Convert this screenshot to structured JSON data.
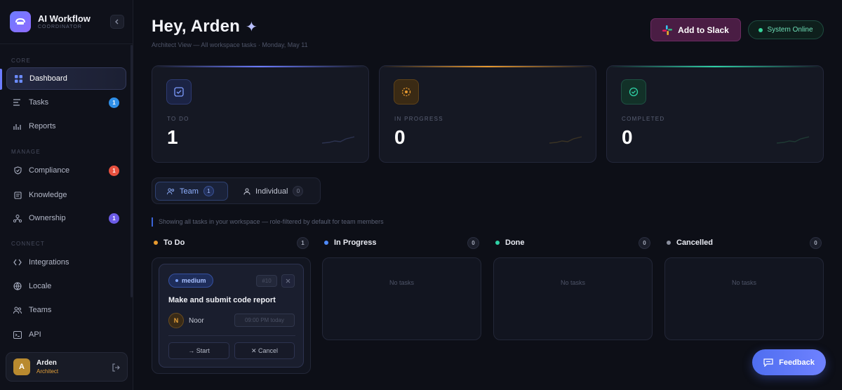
{
  "brand": {
    "name": "AI Workflow",
    "subtitle": "COORDINATOR"
  },
  "sidebar": {
    "sections": [
      {
        "label": "CORE"
      },
      {
        "label": "MANAGE"
      },
      {
        "label": "CONNECT"
      }
    ],
    "items": [
      {
        "label": "Dashboard",
        "icon": "grid-icon",
        "active": true
      },
      {
        "label": "Tasks",
        "icon": "list-icon",
        "badge": "1",
        "badge_color": "#2f8fe8"
      },
      {
        "label": "Reports",
        "icon": "bar-chart-icon"
      },
      {
        "label": "Compliance",
        "icon": "shield-check-icon",
        "badge": "1",
        "badge_color": "#e8513f"
      },
      {
        "label": "Knowledge",
        "icon": "book-icon"
      },
      {
        "label": "Ownership",
        "icon": "user-network-icon",
        "badge": "1",
        "badge_color": "#6c5ce7"
      },
      {
        "label": "Integrations",
        "icon": "code-icon"
      },
      {
        "label": "Locale",
        "icon": "globe-icon"
      },
      {
        "label": "Teams",
        "icon": "users-icon"
      },
      {
        "label": "API",
        "icon": "terminal-icon"
      }
    ],
    "user": {
      "initial": "A",
      "name": "Arden",
      "role": "Architect"
    }
  },
  "header": {
    "greeting": "Hey, Arden",
    "subline": "Architect View — All workspace tasks · Monday, May 11",
    "slack_button": "Add to Slack",
    "status": "System Online"
  },
  "stats": [
    {
      "label": "TO DO",
      "value": "1",
      "accent": "#6c7cff"
    },
    {
      "label": "IN PROGRESS",
      "value": "0",
      "accent": "#e89a2f"
    },
    {
      "label": "COMPLETED",
      "value": "0",
      "accent": "#2fd1a5"
    }
  ],
  "tabs": [
    {
      "label": "Team",
      "count": "1",
      "active": true
    },
    {
      "label": "Individual",
      "count": "0",
      "active": false
    }
  ],
  "info_text": "Showing all tasks in your workspace — role-filtered by default for team members",
  "columns": [
    {
      "title": "To Do",
      "count": "1",
      "dot_color": "#e89a2f"
    },
    {
      "title": "In Progress",
      "count": "0",
      "dot_color": "#4f8bff",
      "empty": "No tasks"
    },
    {
      "title": "Done",
      "count": "0",
      "dot_color": "#2fd1a5",
      "empty": "No tasks"
    },
    {
      "title": "Cancelled",
      "count": "0",
      "dot_color": "#8a8f9e",
      "empty": "No tasks"
    }
  ],
  "task": {
    "priority": "medium",
    "id": "#10",
    "title": "Make and submit code report",
    "assignee_initial": "N",
    "assignee": "Noor",
    "due": "09:00 PM today",
    "start_label": "→ Start",
    "cancel_label": "✕ Cancel"
  },
  "feedback_label": "Feedback"
}
